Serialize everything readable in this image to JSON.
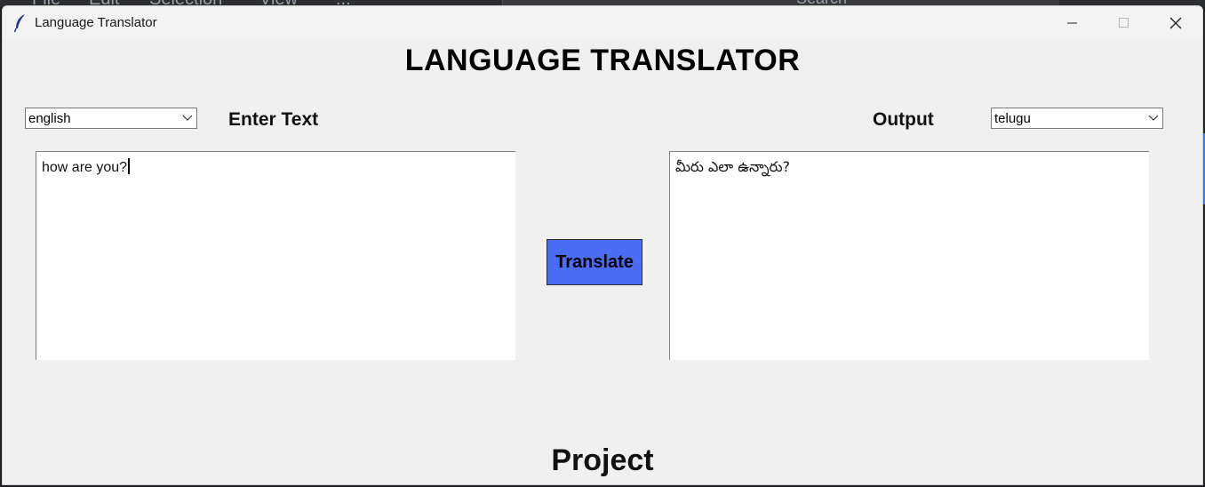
{
  "background_editor": {
    "menu": [
      "File",
      "Edit",
      "Selection",
      "View",
      "..."
    ],
    "search_label": "Search"
  },
  "window": {
    "title": "Language Translator",
    "icon": "feather-icon",
    "controls": [
      "minimize-icon",
      "maximize-icon",
      "close-icon"
    ]
  },
  "app": {
    "heading": "LANGUAGE TRANSLATOR",
    "source_language": "english",
    "target_language": "telugu",
    "enter_label": "Enter Text",
    "output_label": "Output",
    "input_text": "how are you?",
    "output_text": "మీరు ఎలా ఉన్నారు?",
    "translate_label": "Translate",
    "footer": "Project"
  },
  "colors": {
    "window_bg": "#f0f0f0",
    "button_bg": "#4a6cf7"
  }
}
